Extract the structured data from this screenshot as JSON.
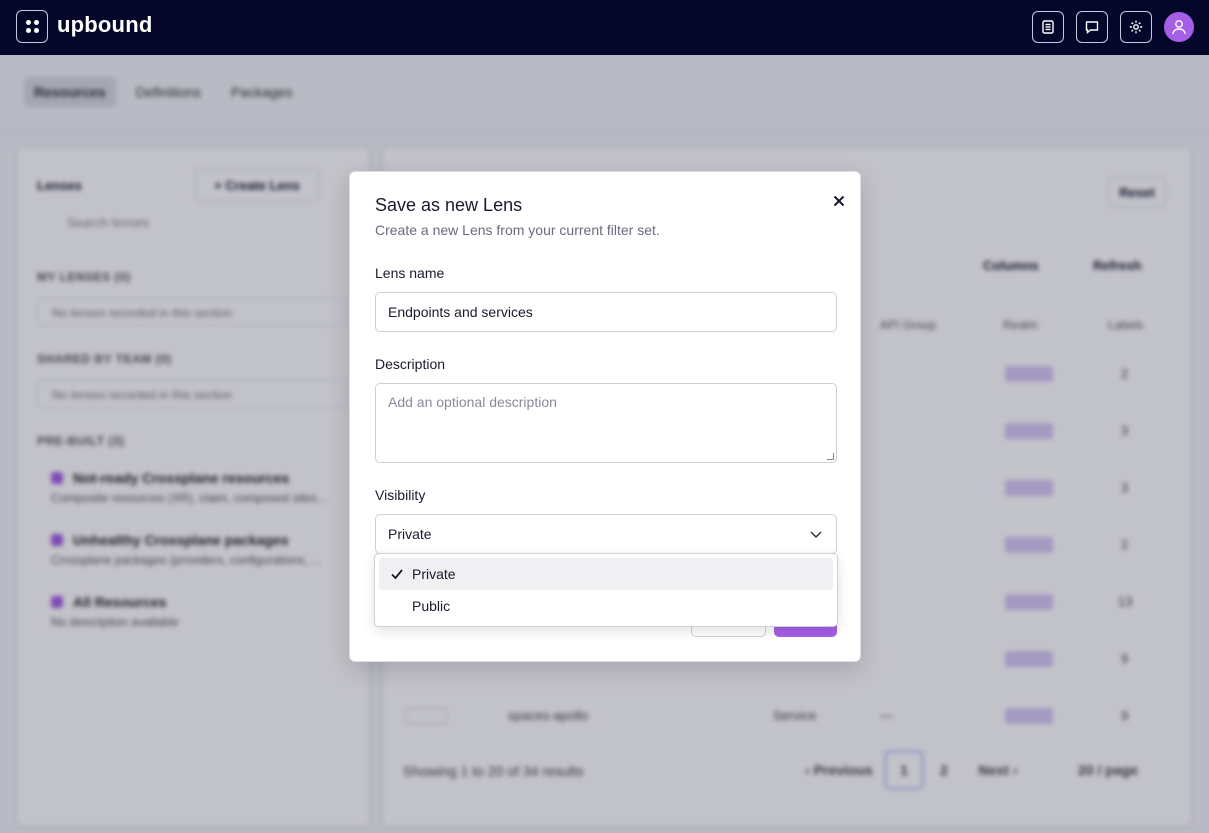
{
  "topbar": {
    "logo": "upbound",
    "icons": [
      "docs-icon",
      "chat-icon",
      "settings-icon",
      "user-avatar-icon"
    ]
  },
  "background": {
    "tabs": [
      "Resources",
      "Definitions",
      "Packages"
    ],
    "lenses": {
      "header": "Lenses",
      "create_label": "+ Create Lens",
      "search_placeholder": "Search lenses",
      "my_lenses": "MY LENSES (0)",
      "shared": "SHARED BY TEAM (0)",
      "prebuilt": "PRE-BUILT (3)",
      "empty_text": "No lenses recorded in this section",
      "items": [
        {
          "title": "Not-ready Crossplane resources",
          "desc": "Composite resources (XR), claim, composed sites..."
        },
        {
          "title": "Unhealthy Crossplane packages",
          "desc": "Crossplane packages (providers, configurations, ..."
        },
        {
          "title": "All Resources",
          "desc": "No description available"
        }
      ]
    },
    "main": {
      "reset": "Reset",
      "columns": "Columns",
      "refresh": "Refresh",
      "col_headers": [
        "API Group",
        "Realm",
        "Labels"
      ],
      "row_counts": [
        "2",
        "3",
        "3",
        "2",
        "13",
        "9",
        "9"
      ],
      "last_row": {
        "name": "spaces-apollo",
        "kind": "Service",
        "group": "—"
      },
      "pager_text": "Showing 1 to 20 of 34 results",
      "prev": "‹ Previous",
      "page1": "1",
      "page2": "2",
      "next": "Next ›",
      "per_page": "20 / page"
    }
  },
  "modal": {
    "title": "Save as new Lens",
    "subtitle": "Create a new Lens from your current filter set.",
    "lens_name_label": "Lens name",
    "lens_name_value": "Endpoints and services",
    "description_label": "Description",
    "description_placeholder": "Add an optional description",
    "visibility_label": "Visibility",
    "visibility_value": "Private",
    "options": [
      "Private",
      "Public"
    ]
  },
  "colors": {
    "topbar": "#05072a",
    "accent": "#a55ee6"
  }
}
